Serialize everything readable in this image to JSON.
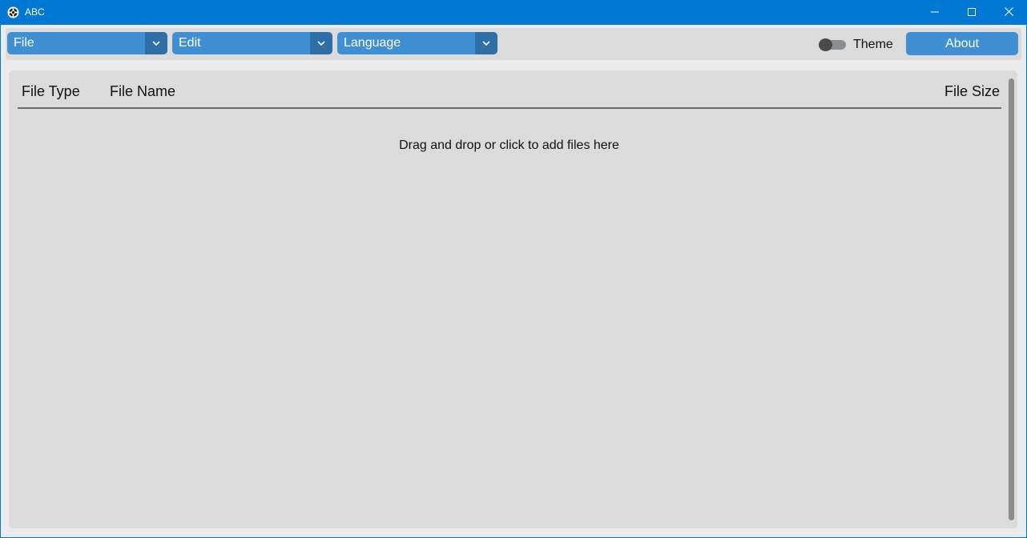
{
  "window": {
    "title": "ABC",
    "accent_color": "#0078d4",
    "controls": [
      "minimize-icon",
      "maximize-icon",
      "close-icon"
    ]
  },
  "toolbar": {
    "menus": [
      {
        "label": "File",
        "icon": "chevron-down-icon"
      },
      {
        "label": "Edit",
        "icon": "chevron-down-icon"
      },
      {
        "label": "Language",
        "icon": "chevron-down-icon"
      }
    ],
    "theme_label": "Theme",
    "theme_enabled": false,
    "about_label": "About",
    "button_color": "#3f8fd2"
  },
  "file_list": {
    "columns": [
      "File Type",
      "File Name",
      "File Size"
    ],
    "rows": [],
    "empty_message": "Drag and drop or click to add files here"
  }
}
